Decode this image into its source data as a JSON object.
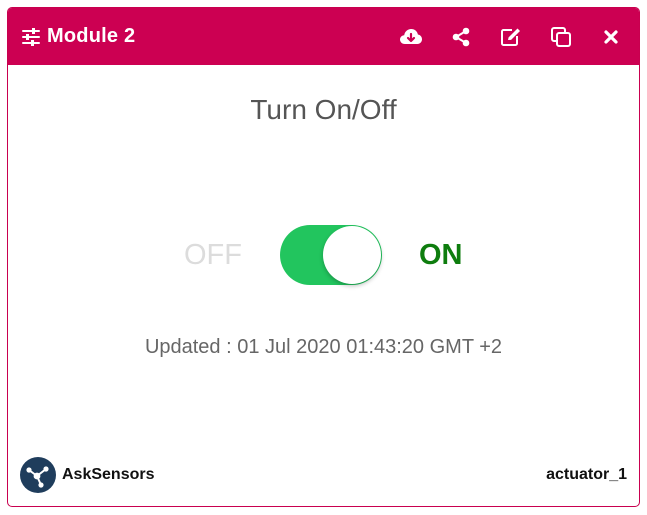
{
  "module": {
    "title": "Module 2",
    "header_icon": "sliders-icon",
    "actions": [
      {
        "name": "download-button",
        "icon": "cloud-download-icon"
      },
      {
        "name": "share-button",
        "icon": "share-icon"
      },
      {
        "name": "edit-button",
        "icon": "edit-icon"
      },
      {
        "name": "copy-button",
        "icon": "copy-icon"
      },
      {
        "name": "close-button",
        "icon": "close-icon"
      }
    ]
  },
  "panel": {
    "title": "Turn On/Off",
    "off_label": "OFF",
    "on_label": "ON",
    "switch_state": "on",
    "updated": "Updated : 01 Jul 2020 01:43:20 GMT +2"
  },
  "footer": {
    "brand": "AskSensors",
    "brand_icon": "asksensors-logo-icon",
    "device": "actuator_1"
  },
  "colors": {
    "header": "#cc0052",
    "toggle_on": "#22c55e",
    "on_text": "#0e7d0e",
    "off_text": "#dcdcdc",
    "logo": "#1f3d5c"
  }
}
